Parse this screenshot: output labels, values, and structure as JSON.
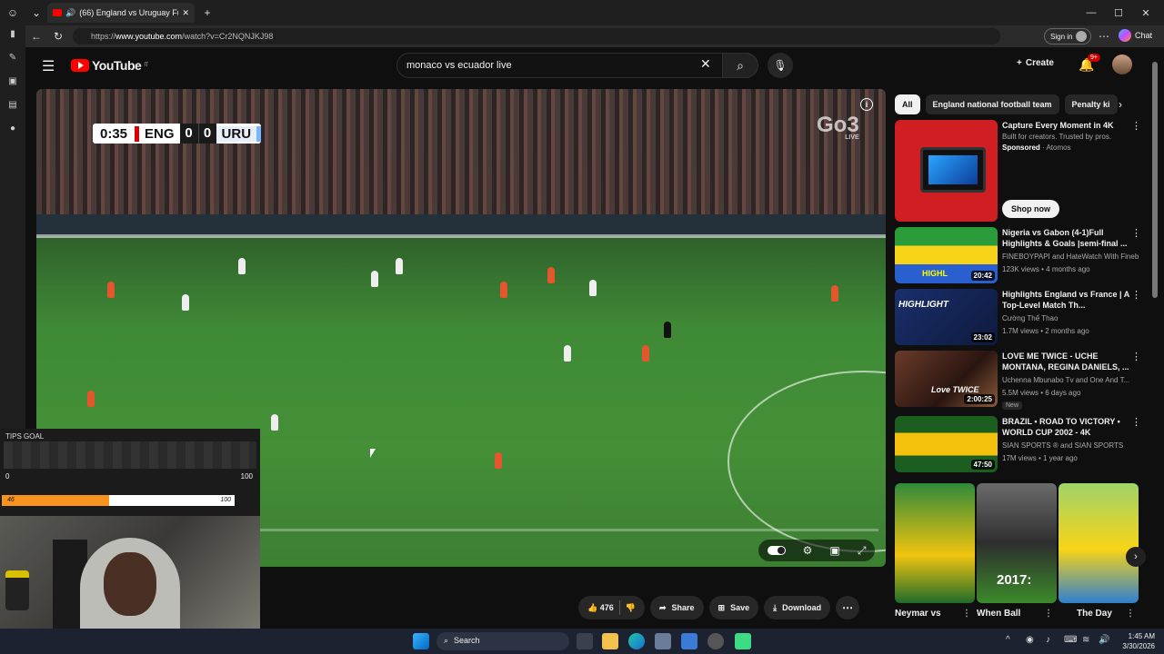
{
  "browser": {
    "tab_title": "(66) England vs Uruguay Full",
    "new_tab": "+",
    "url_prefix": "https://",
    "url_host": "www.youtube.com",
    "url_path": "/watch?v=Cr2NQNJKJ98",
    "sign_in": "Sign in",
    "chat": "Chat"
  },
  "youtube": {
    "logo_text": "YouTube",
    "logo_region": "IT",
    "search_value": "monaco vs ecuador live",
    "create_label": "Create",
    "notif_count": "9+"
  },
  "video": {
    "score_time": "0:35",
    "home_team": "ENG",
    "home_score": "0",
    "away_score": "0",
    "away_team": "URU",
    "broadcaster": "Go3",
    "broadcaster_tag": "LIVE"
  },
  "overlay": {
    "label": "TIPS GOAL",
    "min": "0",
    "max": "100",
    "bar_value": "46",
    "bar_max": "100",
    "progress": 0.46
  },
  "actions": {
    "likes": "476",
    "share": "Share",
    "save": "Save",
    "download": "Download"
  },
  "chips": [
    "All",
    "England national football team",
    "Penalty ki"
  ],
  "recommendations": [
    {
      "title": "Capture Every Moment in 4K",
      "line2": "Built for creators. Trusted by pros.",
      "sponsored": "Sponsored",
      "advertiser": "· Atomos",
      "cta": "Shop now"
    },
    {
      "title": "Nigeria vs Gabon (4-1)Full Highlights & Goals |semi-final ...",
      "channel": "FINEBOYPAPI and HateWatch With Fineb...",
      "meta": "123K views • 4 months ago",
      "duration": "20:42",
      "thumb_text": "HIGHL"
    },
    {
      "title": "Highlights England vs France | A Top-Level Match Th...",
      "channel": "Cường Thể Thao",
      "meta": "1.7M views • 2 months ago",
      "duration": "23:02",
      "thumb_text": "HIGHLIGHT"
    },
    {
      "title": "LOVE ME TWICE - UCHE MONTANA, REGINA DANIELS, ...",
      "channel": "Uchenna Mbunabo Tv and One And T...",
      "meta": "5.5M views • 6 days ago",
      "duration": "2:00:25",
      "badge": "New",
      "thumb_text": "Love TWICE"
    },
    {
      "title": "BRAZIL • ROAD TO VICTORY • WORLD CUP 2002 - 4K",
      "channel": "SIAN SPORTS ® and SIAN SPORTS",
      "meta": "17M views • 1 year ago",
      "duration": "47:50"
    }
  ],
  "shorts": [
    {
      "title": "Neymar vs"
    },
    {
      "title": "When Ball",
      "overlay": "2017:"
    },
    {
      "title": "The Day"
    }
  ],
  "taskbar": {
    "search": "Search",
    "time": "1:45 AM",
    "date": "3/30/2026"
  },
  "colors": {
    "yt_red": "#ff0000",
    "bg": "#0f0f0f",
    "tips_orange": "#f7931e"
  }
}
